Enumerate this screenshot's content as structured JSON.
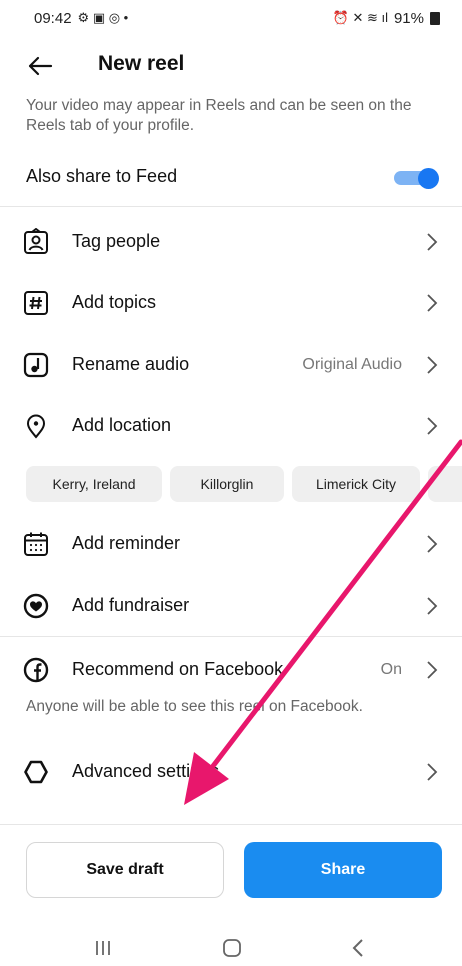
{
  "status_bar": {
    "time": "09:42",
    "left_icons": "⚙ ▣ ◎ •",
    "right_icons": "⏰ ✕ ≋ ıl",
    "battery": "91%"
  },
  "header": {
    "title": "New reel"
  },
  "info_text": "Your video may appear in Reels and can be seen on the Reels tab of your profile.",
  "share_to_feed": {
    "label": "Also share to Feed",
    "on": true
  },
  "rows": [
    {
      "label": "Tag people"
    },
    {
      "label": "Add topics"
    },
    {
      "label": "Rename audio",
      "value": "Original Audio"
    },
    {
      "label": "Add location"
    },
    {
      "label": "Add reminder"
    },
    {
      "label": "Add fundraiser"
    },
    {
      "label": "Recommend on Facebook",
      "value": "On"
    },
    {
      "label": "Advanced settings"
    }
  ],
  "location_chips": [
    "Kerry, Ireland",
    "Killorglin",
    "Limerick City"
  ],
  "facebook_note": "Anyone will be able to see this reel on Facebook.",
  "buttons": {
    "save_draft": "Save draft",
    "share": "Share"
  },
  "colors": {
    "accent": "#1877f2",
    "share_button": "#1a8cf0",
    "annotation_arrow": "#e8176c"
  },
  "icons": [
    "back-arrow-icon",
    "tag-people-icon",
    "hashtag-icon",
    "music-note-icon",
    "location-pin-icon",
    "calendar-icon",
    "heart-coin-icon",
    "facebook-icon",
    "gear-icon",
    "chevron-right-icon"
  ]
}
